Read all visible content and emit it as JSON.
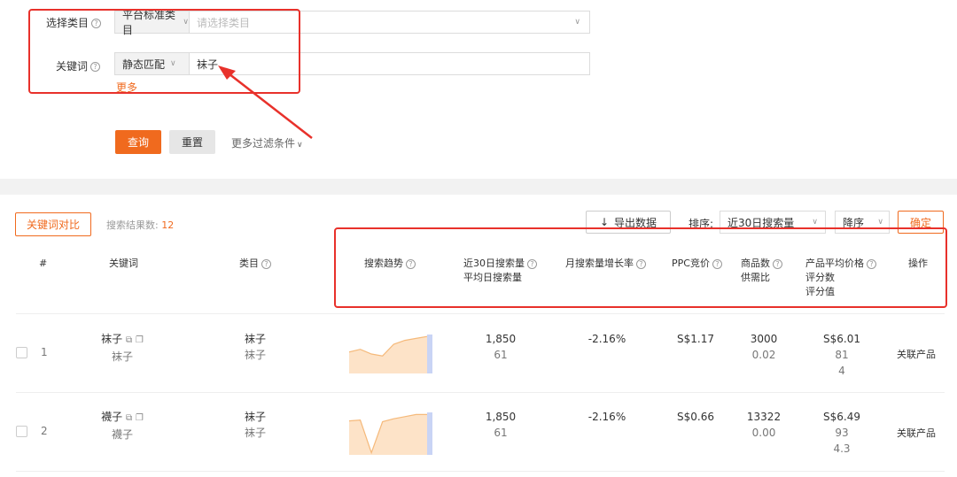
{
  "filters": {
    "category_label": "选择类目",
    "category_type": "平台标准类目",
    "category_placeholder": "请选择类目",
    "keyword_label": "关键词",
    "match_mode": "静态匹配",
    "keyword_value": "袜子",
    "more_link": "更多",
    "query_button": "查询",
    "reset_button": "重置",
    "more_filters": "更多过滤条件"
  },
  "results": {
    "compare_button": "关键词对比",
    "count_label": "搜索结果数:",
    "count_value": "12",
    "export_button": "导出数据",
    "sort_label": "排序:",
    "sort_value": "近30日搜索量",
    "order_value": "降序",
    "confirm_button": "确定"
  },
  "columns": {
    "index": "#",
    "keyword": "关键词",
    "category": "类目",
    "trend": "搜索趋势",
    "volume_30d": "近30日搜索量",
    "volume_daily": "平均日搜索量",
    "monthly_growth": "月搜索量增长率",
    "ppc": "PPC竞价",
    "products": "商品数",
    "supply_demand": "供需比",
    "avg_price": "产品平均价格",
    "rating_count": "评分数",
    "rating_value": "评分值",
    "action": "操作"
  },
  "rows": [
    {
      "index": "1",
      "keyword": "袜子",
      "keyword_sub": "袜子",
      "category": "袜子",
      "category_sub": "袜子",
      "volume_30d": "1,850",
      "volume_daily": "61",
      "growth": "-2.16%",
      "ppc": "S$1.17",
      "products": "3000",
      "supply_demand": "0.02",
      "avg_price": "S$6.01",
      "rating_count": "81",
      "rating_value": "4",
      "action": "关联产品",
      "trend": [
        0.55,
        0.62,
        0.5,
        0.45,
        0.75,
        0.85,
        0.9,
        0.95
      ]
    },
    {
      "index": "2",
      "keyword": "襪子",
      "keyword_sub": "襪子",
      "category": "袜子",
      "category_sub": "袜子",
      "volume_30d": "1,850",
      "volume_daily": "61",
      "growth": "-2.16%",
      "ppc": "S$0.66",
      "products": "13322",
      "supply_demand": "0.00",
      "avg_price": "S$6.49",
      "rating_count": "93",
      "rating_value": "4.3",
      "action": "关联产品",
      "trend": [
        0.8,
        0.82,
        0.05,
        0.78,
        0.85,
        0.9,
        0.95,
        0.95
      ]
    }
  ],
  "colors": {
    "accent": "#f06a1e",
    "highlight": "#e8312b",
    "trend_fill": "#fde3c8",
    "trend_line": "#f5b97a"
  }
}
